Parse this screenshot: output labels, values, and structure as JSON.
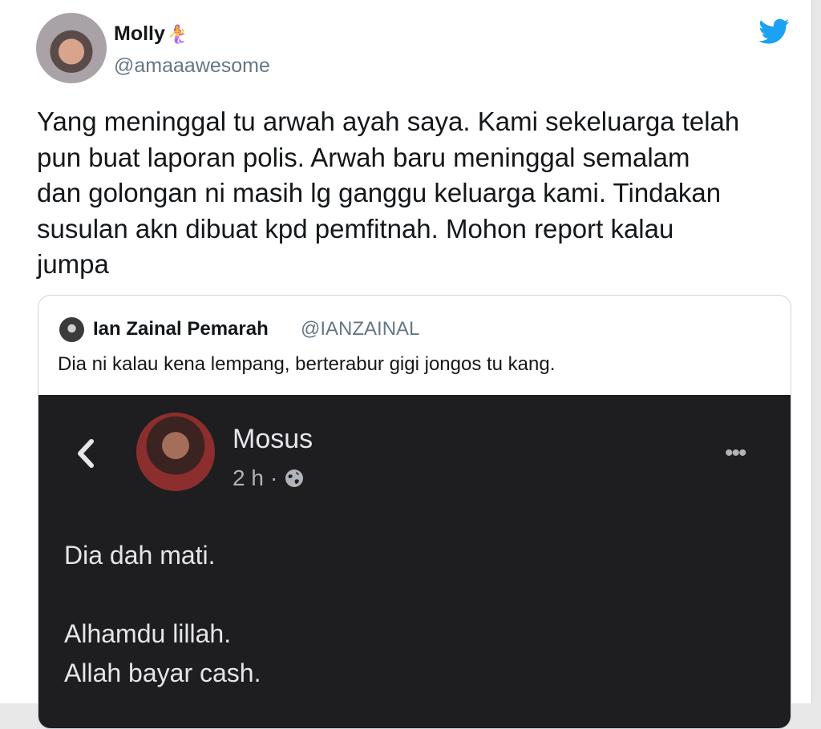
{
  "tweet": {
    "author_name": "Molly",
    "author_emoji": "🧜‍♀️",
    "author_handle": "@amaaawesome",
    "text": "Yang meninggal tu arwah ayah saya. Kami sekeluarga telah\npun buat laporan polis. Arwah baru meninggal semalam\ndan golongan ni masih lg ganggu keluarga kami. Tindakan\nsusulan akn dibuat kpd pemfitnah. Mohon report kalau\njumpa"
  },
  "quoted_tweet": {
    "author_name": "Ian Zainal Pemarah",
    "author_handle": "@IANZAINAL",
    "text": "Dia ni kalau kena lempang, berterabur gigi jongos tu kang."
  },
  "embedded_post": {
    "author_name": "Mosus",
    "time": "2 h",
    "separator": "·",
    "lines": [
      "Dia dah mati.",
      "",
      "Alhamdu lillah.",
      "Allah bayar cash."
    ]
  },
  "colors": {
    "twitter_blue": "#1da1f2",
    "text_primary": "#14171a",
    "text_secondary": "#657786",
    "dark_post_bg": "#1e1e20"
  },
  "icons": {
    "brand": "twitter-bird-icon",
    "back": "chevron-left-icon",
    "privacy": "globe-icon",
    "more": "more-horizontal-icon"
  }
}
